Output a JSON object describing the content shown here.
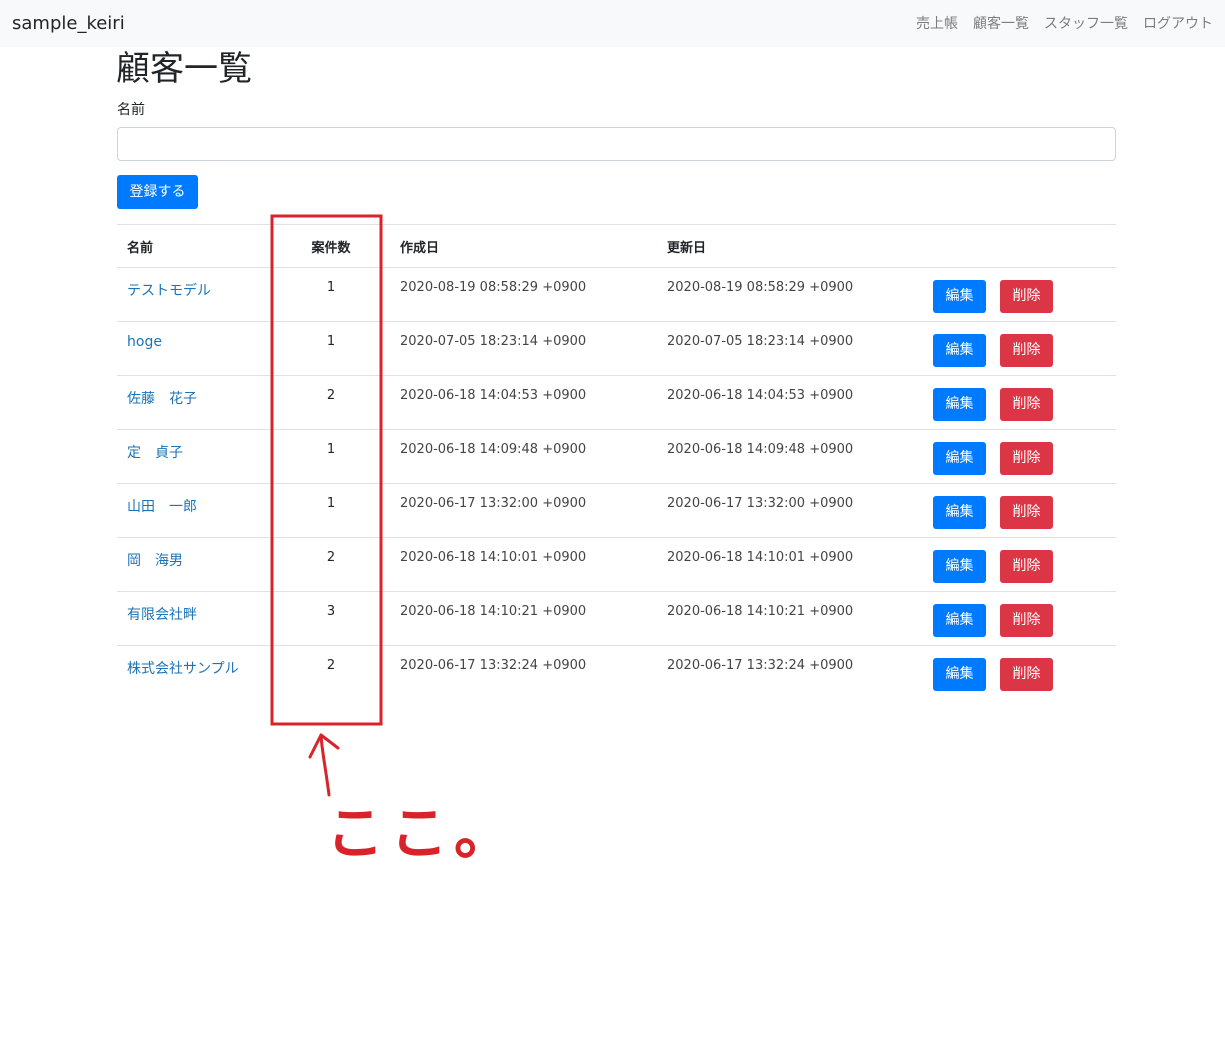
{
  "navbar": {
    "brand": "sample_keiri",
    "links": [
      "売上帳",
      "顧客一覧",
      "スタッフ一覧",
      "ログアウト"
    ]
  },
  "page": {
    "title": "顧客一覧",
    "name_label": "名前",
    "name_value": "",
    "submit_label": "登録する"
  },
  "table": {
    "headers": {
      "name": "名前",
      "count": "案件数",
      "created": "作成日",
      "updated": "更新日"
    },
    "edit_label": "編集",
    "delete_label": "削除",
    "rows": [
      {
        "name": "テストモデル",
        "count": "1",
        "created": "2020-08-19 08:58:29 +0900",
        "updated": "2020-08-19 08:58:29 +0900"
      },
      {
        "name": "hoge",
        "count": "1",
        "created": "2020-07-05 18:23:14 +0900",
        "updated": "2020-07-05 18:23:14 +0900"
      },
      {
        "name": "佐藤　花子",
        "count": "2",
        "created": "2020-06-18 14:04:53 +0900",
        "updated": "2020-06-18 14:04:53 +0900"
      },
      {
        "name": "定　貞子",
        "count": "1",
        "created": "2020-06-18 14:09:48 +0900",
        "updated": "2020-06-18 14:09:48 +0900"
      },
      {
        "name": "山田　一郎",
        "count": "1",
        "created": "2020-06-17 13:32:00 +0900",
        "updated": "2020-06-17 13:32:00 +0900"
      },
      {
        "name": "岡　海男",
        "count": "2",
        "created": "2020-06-18 14:10:01 +0900",
        "updated": "2020-06-18 14:10:01 +0900"
      },
      {
        "name": "有限会社畔",
        "count": "3",
        "created": "2020-06-18 14:10:21 +0900",
        "updated": "2020-06-18 14:10:21 +0900"
      },
      {
        "name": "株式会社サンプル",
        "count": "2",
        "created": "2020-06-17 13:32:24 +0900",
        "updated": "2020-06-17 13:32:24 +0900"
      }
    ]
  },
  "annotation": {
    "color": "#d9232b",
    "text": "ここ。"
  },
  "colors": {
    "primary": "#007bff",
    "danger": "#dc3545",
    "link": "#1a73b7"
  }
}
